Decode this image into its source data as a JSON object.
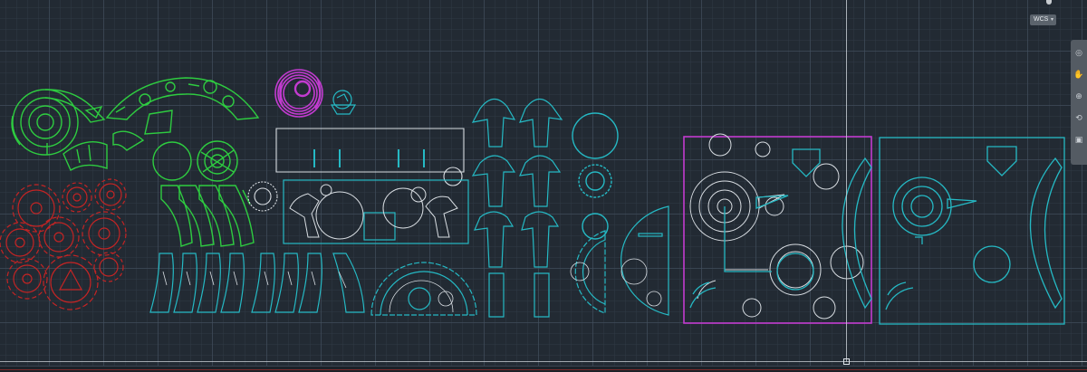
{
  "app": {
    "ucs_label": "WCS",
    "ucs_caret": "▾"
  },
  "colors": {
    "background": "#222a33",
    "green": "#2ecc40",
    "cyan": "#25b9c4",
    "red": "#c42424",
    "magenta": "#c23bd0",
    "white": "#d8dde2"
  },
  "nav_bar": {
    "buttons": [
      "full-navigation-wheel-icon",
      "pan-icon",
      "zoom-icon",
      "orbit-icon",
      "showmotion-icon"
    ]
  }
}
